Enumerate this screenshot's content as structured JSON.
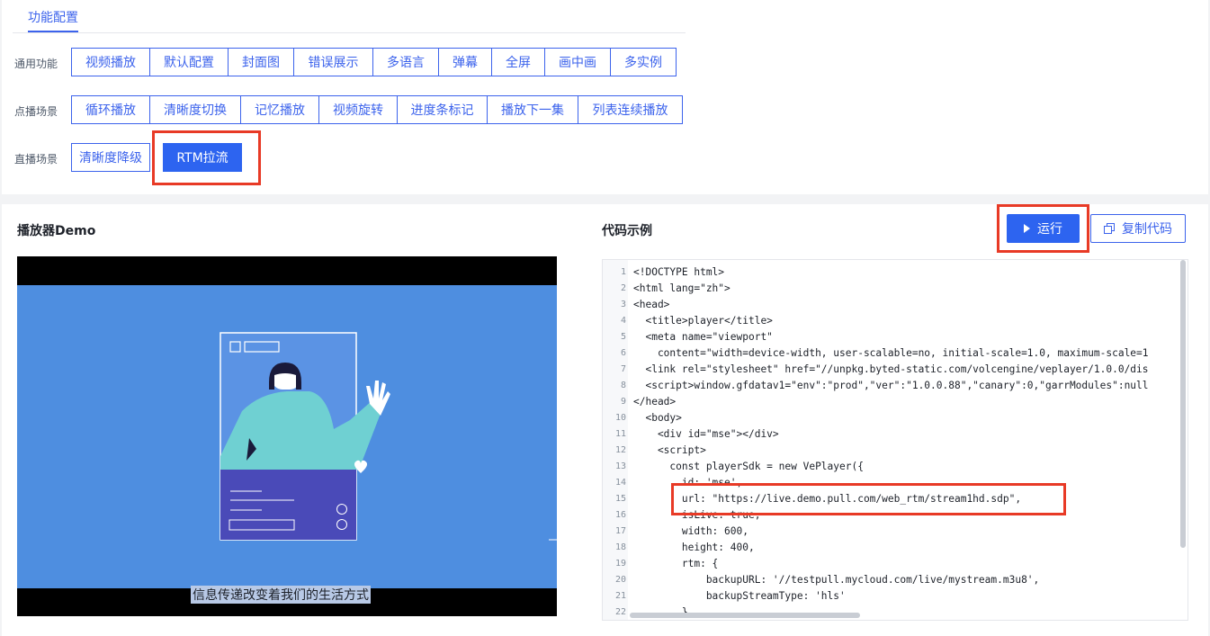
{
  "tab": {
    "label": "功能配置"
  },
  "rows": [
    {
      "label": "通用功能",
      "buttons": [
        "视频播放",
        "默认配置",
        "封面图",
        "错误展示",
        "多语言",
        "弹幕",
        "全屏",
        "画中画",
        "多实例"
      ]
    },
    {
      "label": "点播场景",
      "buttons": [
        "循环播放",
        "清晰度切换",
        "记忆播放",
        "视频旋转",
        "进度条标记",
        "播放下一集",
        "列表连续播放"
      ]
    },
    {
      "label": "直播场景",
      "buttons": [
        "清晰度降级",
        "RTM拉流"
      ],
      "active": "RTM拉流"
    }
  ],
  "player": {
    "title": "播放器Demo",
    "subtitle": "信息传递改变着我们的生活方式"
  },
  "code": {
    "title": "代码示例",
    "run_label": "运行",
    "copy_label": "复制代码",
    "lines": [
      "<!DOCTYPE html>",
      "<html lang=\"zh\">",
      "<head>",
      "  <title>player</title>",
      "  <meta name=\"viewport\"",
      "    content=\"width=device-width, user-scalable=no, initial-scale=1.0, maximum-scale=1",
      "  <link rel=\"stylesheet\" href=\"//unpkg.byted-static.com/volcengine/veplayer/1.0.0/dis",
      "  <script>window.gfdatav1=\"env\":\"prod\",\"ver\":\"1.0.0.88\",\"canary\":0,\"garrModules\":null",
      "</head>",
      "  <body>",
      "    <div id=\"mse\"></div>",
      "    <script>",
      "      const playerSdk = new VePlayer({",
      "        id: 'mse',",
      "        url: \"https://live.demo.pull.com/web_rtm/stream1hd.sdp\",",
      "        isLive: true,",
      "        width: 600,",
      "        height: 400,",
      "        rtm: {",
      "            backupURL: '//testpull.mycloud.com/live/mystream.m3u8',",
      "            backupStreamType: 'hls'",
      "        }"
    ]
  },
  "colors": {
    "accent": "#2d64f0",
    "highlight": "#e83a26",
    "stage": "#4e8ee0"
  }
}
